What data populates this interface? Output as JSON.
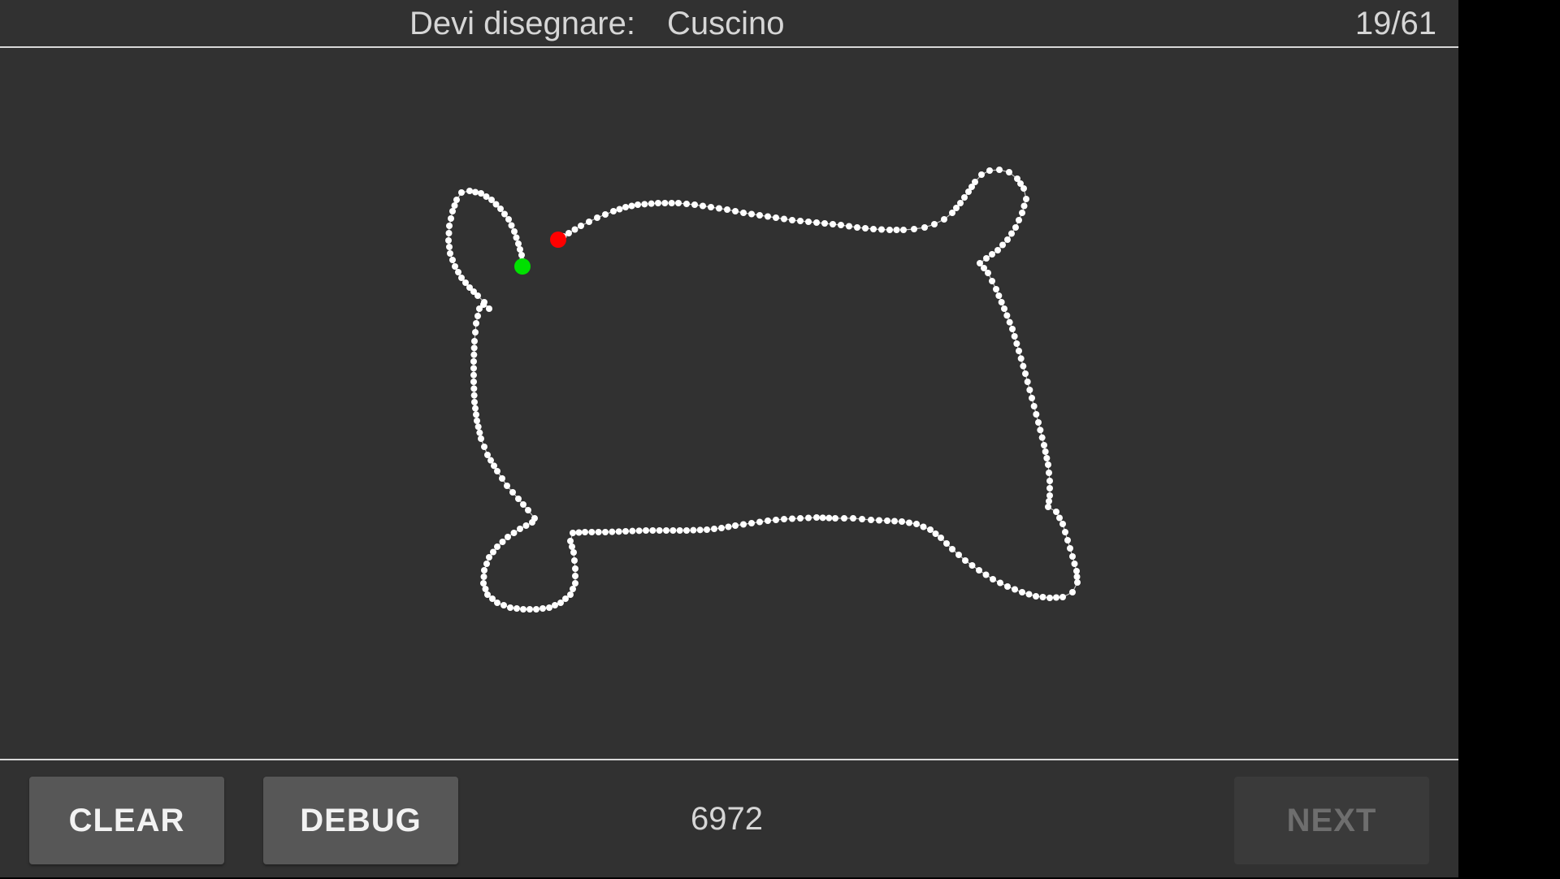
{
  "header": {
    "prompt_label": "Devi disegnare:",
    "prompt_word": "Cuscino",
    "progress": "19/61"
  },
  "footer": {
    "clear_label": "CLEAR",
    "debug_label": "DEBUG",
    "score": "6972",
    "next_label": "NEXT",
    "next_enabled": false
  },
  "colors": {
    "background": "#313131",
    "stroke_points": "#ffffff",
    "start_marker": "#00e000",
    "end_marker": "#ff0000"
  }
}
